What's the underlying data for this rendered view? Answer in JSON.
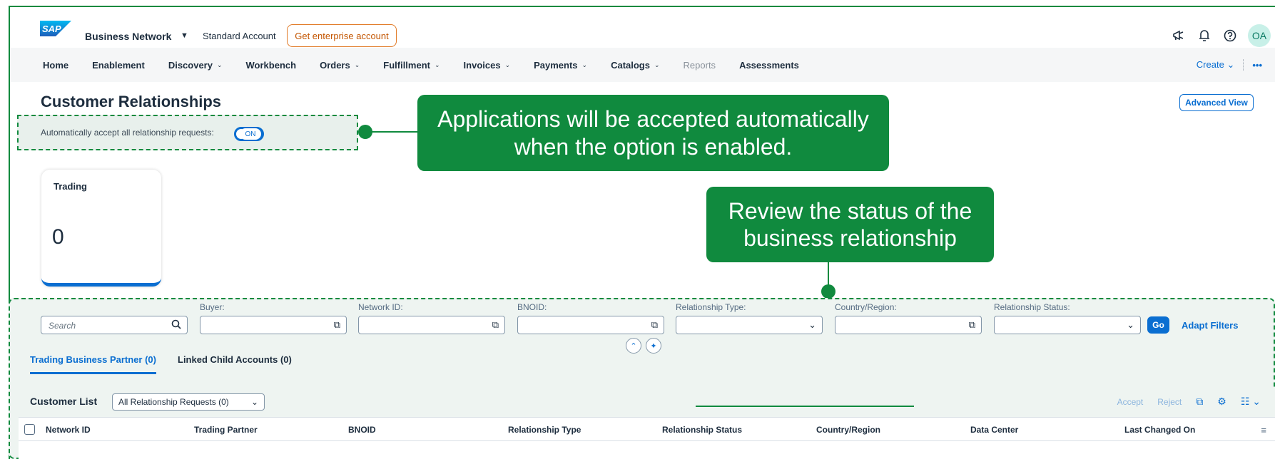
{
  "shell": {
    "logo_text": "SAP",
    "brand": "Business Network",
    "caret": "▼",
    "account": "Standard Account",
    "enterprise_button": "Get enterprise account",
    "avatar_initials": "OA"
  },
  "nav": {
    "items": [
      {
        "label": "Home",
        "chevron": ""
      },
      {
        "label": "Enablement",
        "chevron": ""
      },
      {
        "label": "Discovery",
        "chevron": "⌄"
      },
      {
        "label": "Workbench",
        "chevron": ""
      },
      {
        "label": "Orders",
        "chevron": "⌄"
      },
      {
        "label": "Fulfillment",
        "chevron": "⌄"
      },
      {
        "label": "Invoices",
        "chevron": "⌄"
      },
      {
        "label": "Payments",
        "chevron": "⌄"
      },
      {
        "label": "Catalogs",
        "chevron": "⌄"
      },
      {
        "label": "Reports",
        "chevron": ""
      },
      {
        "label": "Assessments",
        "chevron": ""
      }
    ],
    "create_label": "Create",
    "more": "•••"
  },
  "page": {
    "title": "Customer Relationships",
    "advanced_view": "Advanced View",
    "auto_accept_label": "Automatically accept all relationship requests:",
    "toggle_text": "ON"
  },
  "callouts": {
    "first": "Applications will be accepted automatically when the option is enabled.",
    "second": "Review the status of the business relationship"
  },
  "tile": {
    "title": "Trading",
    "value": "0"
  },
  "filters": {
    "search_placeholder": "Search",
    "labels": [
      "Buyer:",
      "Network ID:",
      "BNOID:",
      "Relationship Type:",
      "Country/Region:",
      "Relationship Status:"
    ],
    "go": "Go",
    "adapt": "Adapt Filters"
  },
  "tabs": [
    {
      "label": "Trading Business Partner (0)",
      "active": true
    },
    {
      "label": "Linked Child Accounts (0)",
      "active": false
    }
  ],
  "table": {
    "title": "Customer List",
    "select_value": "All Relationship Requests (0)",
    "accept": "Accept",
    "reject": "Reject",
    "columns": [
      "Network ID",
      "Trading Partner",
      "BNOID",
      "Relationship Type",
      "Relationship Status",
      "Country/Region",
      "Data Center",
      "Last Changed On"
    ]
  },
  "colors": {
    "accent": "#0a6ed1",
    "callout_green": "#108a3e",
    "enterprise_orange": "#c35500"
  }
}
